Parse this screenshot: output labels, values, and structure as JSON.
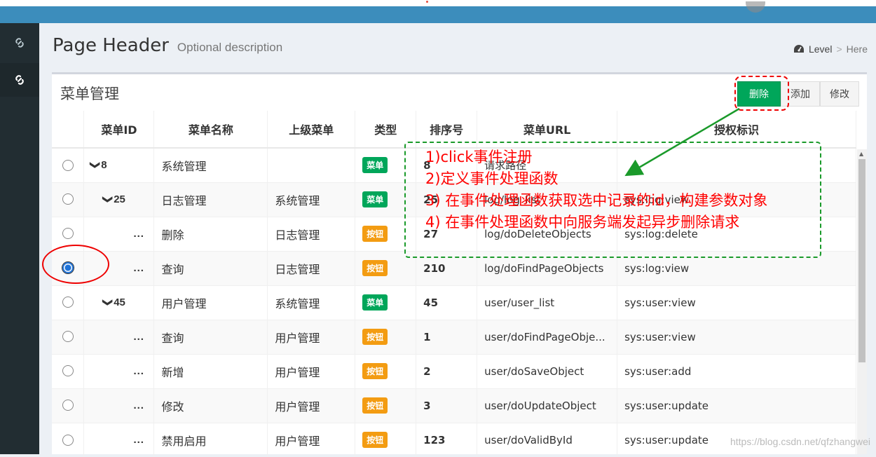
{
  "header": {
    "title": "Page Header",
    "description": "Optional description"
  },
  "breadcrumb": {
    "level": "Level",
    "separator": ">",
    "here": "Here"
  },
  "sidebar": {
    "items": [
      {
        "icon": "link-icon",
        "active": false
      },
      {
        "icon": "link-icon",
        "active": true
      }
    ]
  },
  "box": {
    "title": "菜单管理",
    "buttons": {
      "delete": "删除",
      "add": "添加",
      "edit": "修改"
    }
  },
  "table": {
    "columns": [
      "",
      "菜单ID",
      "菜单名称",
      "上级菜单",
      "类型",
      "排序号",
      "菜单URL",
      "授权标识"
    ],
    "rows": [
      {
        "id": "8",
        "level": 0,
        "name": "系统管理",
        "parent": "",
        "type": "菜单",
        "sort": "8",
        "url": "请求路径",
        "perm": "",
        "checked": false
      },
      {
        "id": "25",
        "level": 1,
        "name": "日志管理",
        "parent": "系统管理",
        "type": "菜单",
        "sort": "25",
        "url": "log/log_list",
        "perm": "sys:log:view",
        "checked": false
      },
      {
        "id": "...",
        "level": 2,
        "name": "删除",
        "parent": "日志管理",
        "type": "按钮",
        "sort": "27",
        "url": "log/doDeleteObjects",
        "perm": "sys:log:delete",
        "checked": false
      },
      {
        "id": "...",
        "level": 2,
        "name": "查询",
        "parent": "日志管理",
        "type": "按钮",
        "sort": "210",
        "url": "log/doFindPageObjects",
        "perm": "sys:log:view",
        "checked": true
      },
      {
        "id": "45",
        "level": 1,
        "name": "用户管理",
        "parent": "系统管理",
        "type": "菜单",
        "sort": "45",
        "url": "user/user_list",
        "perm": "sys:user:view",
        "checked": false
      },
      {
        "id": "...",
        "level": 2,
        "name": "查询",
        "parent": "用户管理",
        "type": "按钮",
        "sort": "1",
        "url": "user/doFindPageObje...",
        "perm": "sys:user:view",
        "checked": false
      },
      {
        "id": "...",
        "level": 2,
        "name": "新增",
        "parent": "用户管理",
        "type": "按钮",
        "sort": "2",
        "url": "user/doSaveObject",
        "perm": "sys:user:add",
        "checked": false
      },
      {
        "id": "...",
        "level": 2,
        "name": "修改",
        "parent": "用户管理",
        "type": "按钮",
        "sort": "3",
        "url": "user/doUpdateObject",
        "perm": "sys:user:update",
        "checked": false
      },
      {
        "id": "...",
        "level": 2,
        "name": "禁用启用",
        "parent": "用户管理",
        "type": "按钮",
        "sort": "123",
        "url": "user/doValidById",
        "perm": "sys:user:update",
        "checked": false
      }
    ]
  },
  "annotation": {
    "lines": [
      "1)click事件注册",
      "2)定义事件处理函数",
      "3) 在事件处理函数获取选中记录的id，构建参数对象",
      "4) 在事件处理函数中向服务端发起异步删除请求"
    ]
  },
  "watermark": "https://blog.csdn.net/qfzhangwei",
  "colors": {
    "topbar": "#3c8dbc",
    "sidebar": "#222d32",
    "menu_badge": "#00a65a",
    "button_badge": "#f39c12",
    "annotation_text": "#ff0000",
    "annotation_border": "#1a9a2a"
  }
}
